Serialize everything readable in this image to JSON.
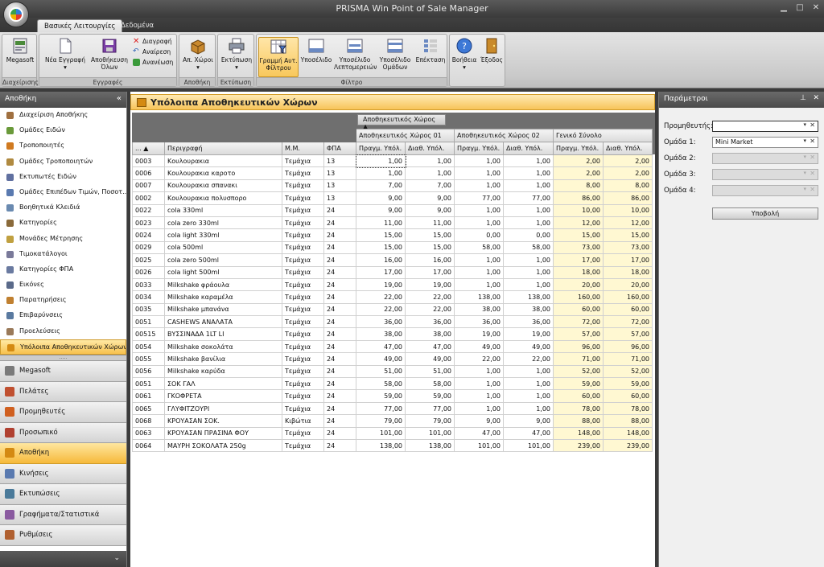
{
  "window": {
    "title": "PRISMA Win Point of Sale Manager"
  },
  "ribbon_tabs": [
    "Βασικές Λειτουργίες",
    "Δεδομένα"
  ],
  "ribbon": {
    "megasoft": "Megasoft",
    "group_management": "Διαχείρισης",
    "new_record": "Νέα Εγγραφή",
    "save_all": "Αποθήκευση Όλων",
    "delete": "Διαγραφή",
    "undo": "Αναίρεση",
    "refresh": "Ανανέωση",
    "group_records": "Εγγραφές",
    "stores": "Απ. Χώροι",
    "group_store": "Αποθήκη",
    "print": "Εκτύπωση",
    "group_print": "Εκτύπωση",
    "filter_row": "Γραμμή Αυτ. Φίλτρου",
    "summary": "Υποσέλιδο",
    "detail_footer": "Υποσέλιδο Λεπτομερειών",
    "group_footer": "Υποσέλιδο Ομάδων",
    "expand": "Επέκταση",
    "group_filter": "Φίλτρο",
    "help": "Βοήθεια",
    "exit": "Έξοδος"
  },
  "nav": {
    "title": "Αποθήκη",
    "items": [
      "Διαχείριση Αποθήκης",
      "Ομάδες Ειδών",
      "Τροποποιητές",
      "Ομάδες Τροποποιητών",
      "Εκτυπωτές Ειδών",
      "Ομάδες Επιπέδων Τιμών, Ποσοτ...",
      "Βοηθητικά Κλειδιά",
      "Κατηγορίες",
      "Μονάδες Μέτρησης",
      "Τιμοκατάλογοι",
      "Κατηγορίες ΦΠΑ",
      "Εικόνες",
      "Παρατηρήσεις",
      "Επιβαρύνσεις",
      "Προελεύσεις",
      "Υπόλοιπα Αποθηκευτικών Χώρων"
    ],
    "categories": [
      "Megasoft",
      "Πελάτες",
      "Προμηθευτές",
      "Προσωπικό",
      "Αποθήκη",
      "Κινήσεις",
      "Εκτυπώσεις",
      "Γραφήματα/Στατιστικά",
      "Ρυθμίσεις"
    ]
  },
  "main": {
    "title": "Υπόλοιπα Αποθηκευτικών Χώρων",
    "group_chip": "Αποθηκευτικός Χώρος",
    "col_code": "...",
    "col_desc": "Περιγραφή",
    "col_unit": "Μ.Μ.",
    "col_vat": "ΦΠΑ",
    "store1": "Αποθηκευτικός Χώρος 01",
    "store2": "Αποθηκευτικός Χώρος 02",
    "total": "Γενικό Σύνολο",
    "actual": "Πραγμ. Υπόλ.",
    "avail": "Διαθ. Υπόλ.",
    "rows": [
      [
        "0003",
        "Κουλουρακια",
        "Τεμάχια",
        "13",
        "1,00",
        "1,00",
        "1,00",
        "1,00",
        "2,00",
        "2,00"
      ],
      [
        "0006",
        "Κουλουρακια καροτο",
        "Τεμάχια",
        "13",
        "1,00",
        "1,00",
        "1,00",
        "1,00",
        "2,00",
        "2,00"
      ],
      [
        "0007",
        "Κουλουρακια σπανακι",
        "Τεμάχια",
        "13",
        "7,00",
        "7,00",
        "1,00",
        "1,00",
        "8,00",
        "8,00"
      ],
      [
        "0002",
        "Κουλουρακια πολυσπορο",
        "Τεμάχια",
        "13",
        "9,00",
        "9,00",
        "77,00",
        "77,00",
        "86,00",
        "86,00"
      ],
      [
        "0022",
        "cola 330ml",
        "Τεμάχια",
        "24",
        "9,00",
        "9,00",
        "1,00",
        "1,00",
        "10,00",
        "10,00"
      ],
      [
        "0023",
        "cola zero 330ml",
        "Τεμάχια",
        "24",
        "11,00",
        "11,00",
        "1,00",
        "1,00",
        "12,00",
        "12,00"
      ],
      [
        "0024",
        "cola light 330ml",
        "Τεμάχια",
        "24",
        "15,00",
        "15,00",
        "0,00",
        "0,00",
        "15,00",
        "15,00"
      ],
      [
        "0029",
        "cola 500ml",
        "Τεμάχια",
        "24",
        "15,00",
        "15,00",
        "58,00",
        "58,00",
        "73,00",
        "73,00"
      ],
      [
        "0025",
        "cola zero 500ml",
        "Τεμάχια",
        "24",
        "16,00",
        "16,00",
        "1,00",
        "1,00",
        "17,00",
        "17,00"
      ],
      [
        "0026",
        "cola light 500ml",
        "Τεμάχια",
        "24",
        "17,00",
        "17,00",
        "1,00",
        "1,00",
        "18,00",
        "18,00"
      ],
      [
        "0033",
        "Milkshake φράουλα",
        "Τεμάχια",
        "24",
        "19,00",
        "19,00",
        "1,00",
        "1,00",
        "20,00",
        "20,00"
      ],
      [
        "0034",
        "Milkshake καραμέλα",
        "Τεμάχια",
        "24",
        "22,00",
        "22,00",
        "138,00",
        "138,00",
        "160,00",
        "160,00"
      ],
      [
        "0035",
        "Milkshake μπανάνα",
        "Τεμάχια",
        "24",
        "22,00",
        "22,00",
        "38,00",
        "38,00",
        "60,00",
        "60,00"
      ],
      [
        "0051",
        "CASHEWS ΑΝΑΛΑΤΑ",
        "Τεμάχια",
        "24",
        "36,00",
        "36,00",
        "36,00",
        "36,00",
        "72,00",
        "72,00"
      ],
      [
        "00515",
        "ΒΥΣΣΙΝΑΔΑ 1LT LI",
        "Τεμάχια",
        "24",
        "38,00",
        "38,00",
        "19,00",
        "19,00",
        "57,00",
        "57,00"
      ],
      [
        "0054",
        "Milkshake σοκολάτα",
        "Τεμάχια",
        "24",
        "47,00",
        "47,00",
        "49,00",
        "49,00",
        "96,00",
        "96,00"
      ],
      [
        "0055",
        "Milkshake βανίλια",
        "Τεμάχια",
        "24",
        "49,00",
        "49,00",
        "22,00",
        "22,00",
        "71,00",
        "71,00"
      ],
      [
        "0056",
        "Milkshake καρύδα",
        "Τεμάχια",
        "24",
        "51,00",
        "51,00",
        "1,00",
        "1,00",
        "52,00",
        "52,00"
      ],
      [
        "0051",
        "ΣΟΚ ΓΑΛ",
        "Τεμάχια",
        "24",
        "58,00",
        "58,00",
        "1,00",
        "1,00",
        "59,00",
        "59,00"
      ],
      [
        "0061",
        "ΓΚΟΦΡΕΤΑ",
        "Τεμάχια",
        "24",
        "59,00",
        "59,00",
        "1,00",
        "1,00",
        "60,00",
        "60,00"
      ],
      [
        "0065",
        "ΓΛΥΦΙΤΖΟΥΡΙ",
        "Τεμάχια",
        "24",
        "77,00",
        "77,00",
        "1,00",
        "1,00",
        "78,00",
        "78,00"
      ],
      [
        "0068",
        "ΚΡΟΥΑΣΑΝ ΣΟΚ.",
        "Κιβώτια",
        "24",
        "79,00",
        "79,00",
        "9,00",
        "9,00",
        "88,00",
        "88,00"
      ],
      [
        "0063",
        "ΚΡΟΥΑΣΑΝ ΠΡΑΣΙΝΑ ΦΟΥ",
        "Τεμάχια",
        "24",
        "101,00",
        "101,00",
        "47,00",
        "47,00",
        "148,00",
        "148,00"
      ],
      [
        "0064",
        "ΜΑΥΡΗ ΣΟΚΟΛΑΤΑ 250g",
        "Τεμάχια",
        "24",
        "138,00",
        "138,00",
        "101,00",
        "101,00",
        "239,00",
        "239,00"
      ]
    ]
  },
  "params": {
    "title": "Παράμετροι",
    "supplier_label": "Προμηθευτής:",
    "supplier_value": "",
    "group1_label": "Ομάδα 1:",
    "group1_value": "Mini Market",
    "group2_label": "Ομάδα 2:",
    "group3_label": "Ομάδα 3:",
    "group4_label": "Ομάδα 4:",
    "submit": "Υποβολή"
  },
  "colors": {
    "accent": "#f7c45a",
    "total_bg": "#fff8d2"
  }
}
